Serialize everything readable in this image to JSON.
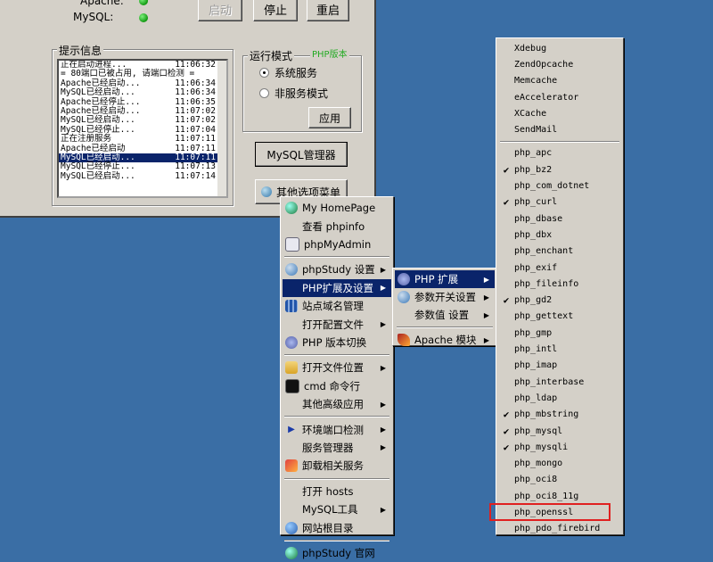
{
  "status": {
    "apache_label": "Apache:",
    "mysql_label": "MySQL:"
  },
  "buttons": {
    "start": "启动",
    "stop": "停止",
    "restart": "重启"
  },
  "log_group": {
    "title": "提示信息",
    "lines": [
      {
        "text": "正在启动进程...",
        "time": "11:06:32"
      },
      {
        "text": "= 80端口已被占用, 请端口检测 =",
        "time": ""
      },
      {
        "text": "Apache已经启动...",
        "time": "11:06:34"
      },
      {
        "text": "MySQL已经启动...",
        "time": "11:06:34"
      },
      {
        "text": "Apache已经停止...",
        "time": "11:06:35"
      },
      {
        "text": "Apache已经启动...",
        "time": "11:07:02"
      },
      {
        "text": "MySQL已经启动...",
        "time": "11:07:02"
      },
      {
        "text": "MySQL已经停止...",
        "time": "11:07:04"
      },
      {
        "text": "正在注册服务",
        "time": "11:07:11"
      },
      {
        "text": "Apache已经启动",
        "time": "11:07:11"
      },
      {
        "text": "MySQL已经启动...",
        "time": "11:07:11"
      },
      {
        "text": "MySQL已经停止...",
        "time": "11:07:13"
      },
      {
        "text": "MySQL已经启动...",
        "time": "11:07:14"
      }
    ],
    "selected_index": 10
  },
  "mode_group": {
    "title": "运行模式",
    "php_version_link": "PHP版本",
    "option_service": "系统服务",
    "option_nonservice": "非服务模式",
    "apply": "应用"
  },
  "mysql_manager": "MySQL管理器",
  "other_menu_button": "其他选项菜单",
  "menu_main": [
    {
      "label": "My HomePage",
      "icon": "globe-icon",
      "arrow": false
    },
    {
      "label": "查看 phpinfo",
      "icon": "",
      "arrow": false
    },
    {
      "label": "phpMyAdmin",
      "icon": "phpmyadmin-icon",
      "arrow": false
    },
    {
      "sep": true
    },
    {
      "label": "phpStudy 设置",
      "icon": "gear-icon",
      "arrow": true
    },
    {
      "label": "PHP扩展及设置",
      "icon": "",
      "arrow": true,
      "hl": true
    },
    {
      "label": "站点域名管理",
      "icon": "grid-icon",
      "arrow": false
    },
    {
      "label": "打开配置文件",
      "icon": "",
      "arrow": true
    },
    {
      "label": "PHP 版本切换",
      "icon": "php-icon",
      "arrow": false
    },
    {
      "sep": true
    },
    {
      "label": "打开文件位置",
      "icon": "folder-icon",
      "arrow": true
    },
    {
      "label": "cmd 命令行",
      "icon": "terminal-icon",
      "arrow": false
    },
    {
      "label": "其他高级应用",
      "icon": "",
      "arrow": true
    },
    {
      "sep": true
    },
    {
      "label": "环境端口检测",
      "icon": "arrow-right-icon",
      "arrow": true
    },
    {
      "label": "服务管理器",
      "icon": "",
      "arrow": true
    },
    {
      "label": "卸载相关服务",
      "icon": "uninstall-icon",
      "arrow": false
    },
    {
      "sep": true
    },
    {
      "label": "打开 hosts",
      "icon": "",
      "arrow": false
    },
    {
      "label": "MySQL工具",
      "icon": "",
      "arrow": true
    },
    {
      "label": "网站根目录",
      "icon": "globe-folder-icon",
      "arrow": false
    },
    {
      "sep": true
    },
    {
      "label": "phpStudy 官网",
      "icon": "globe-icon",
      "arrow": false
    }
  ],
  "menu_sub": [
    {
      "label": "PHP 扩展",
      "icon": "php-icon",
      "arrow": true,
      "hl": true
    },
    {
      "label": "参数开关设置",
      "icon": "gear-icon",
      "arrow": true
    },
    {
      "label": "参数值 设置",
      "icon": "",
      "arrow": true
    },
    {
      "sep": true
    },
    {
      "label": "Apache 模块",
      "icon": "feather-icon",
      "arrow": true
    }
  ],
  "menu_ext": [
    {
      "name": "Xdebug",
      "checked": false
    },
    {
      "name": "ZendOpcache",
      "checked": false
    },
    {
      "name": "Memcache",
      "checked": false
    },
    {
      "name": "eAccelerator",
      "checked": false
    },
    {
      "name": "XCache",
      "checked": false
    },
    {
      "name": "SendMail",
      "checked": false
    },
    {
      "sep": true
    },
    {
      "name": "php_apc",
      "checked": false
    },
    {
      "name": "php_bz2",
      "checked": true
    },
    {
      "name": "php_com_dotnet",
      "checked": false
    },
    {
      "name": "php_curl",
      "checked": true
    },
    {
      "name": "php_dbase",
      "checked": false
    },
    {
      "name": "php_dbx",
      "checked": false
    },
    {
      "name": "php_enchant",
      "checked": false
    },
    {
      "name": "php_exif",
      "checked": false
    },
    {
      "name": "php_fileinfo",
      "checked": false
    },
    {
      "name": "php_gd2",
      "checked": true
    },
    {
      "name": "php_gettext",
      "checked": false
    },
    {
      "name": "php_gmp",
      "checked": false
    },
    {
      "name": "php_intl",
      "checked": false
    },
    {
      "name": "php_imap",
      "checked": false
    },
    {
      "name": "php_interbase",
      "checked": false
    },
    {
      "name": "php_ldap",
      "checked": false
    },
    {
      "name": "php_mbstring",
      "checked": true
    },
    {
      "name": "php_mysql",
      "checked": true
    },
    {
      "name": "php_mysqli",
      "checked": true
    },
    {
      "name": "php_mongo",
      "checked": false
    },
    {
      "name": "php_oci8",
      "checked": false
    },
    {
      "name": "php_oci8_11g",
      "checked": false
    },
    {
      "name": "php_openssl",
      "checked": false,
      "boxed": true
    },
    {
      "name": "php_pdo_firebird",
      "checked": false
    }
  ],
  "colors": {
    "desktop": "#3a6ea5",
    "highlight": "#0a246a",
    "annotation_box": "#e02020",
    "status_green": "#119911"
  }
}
